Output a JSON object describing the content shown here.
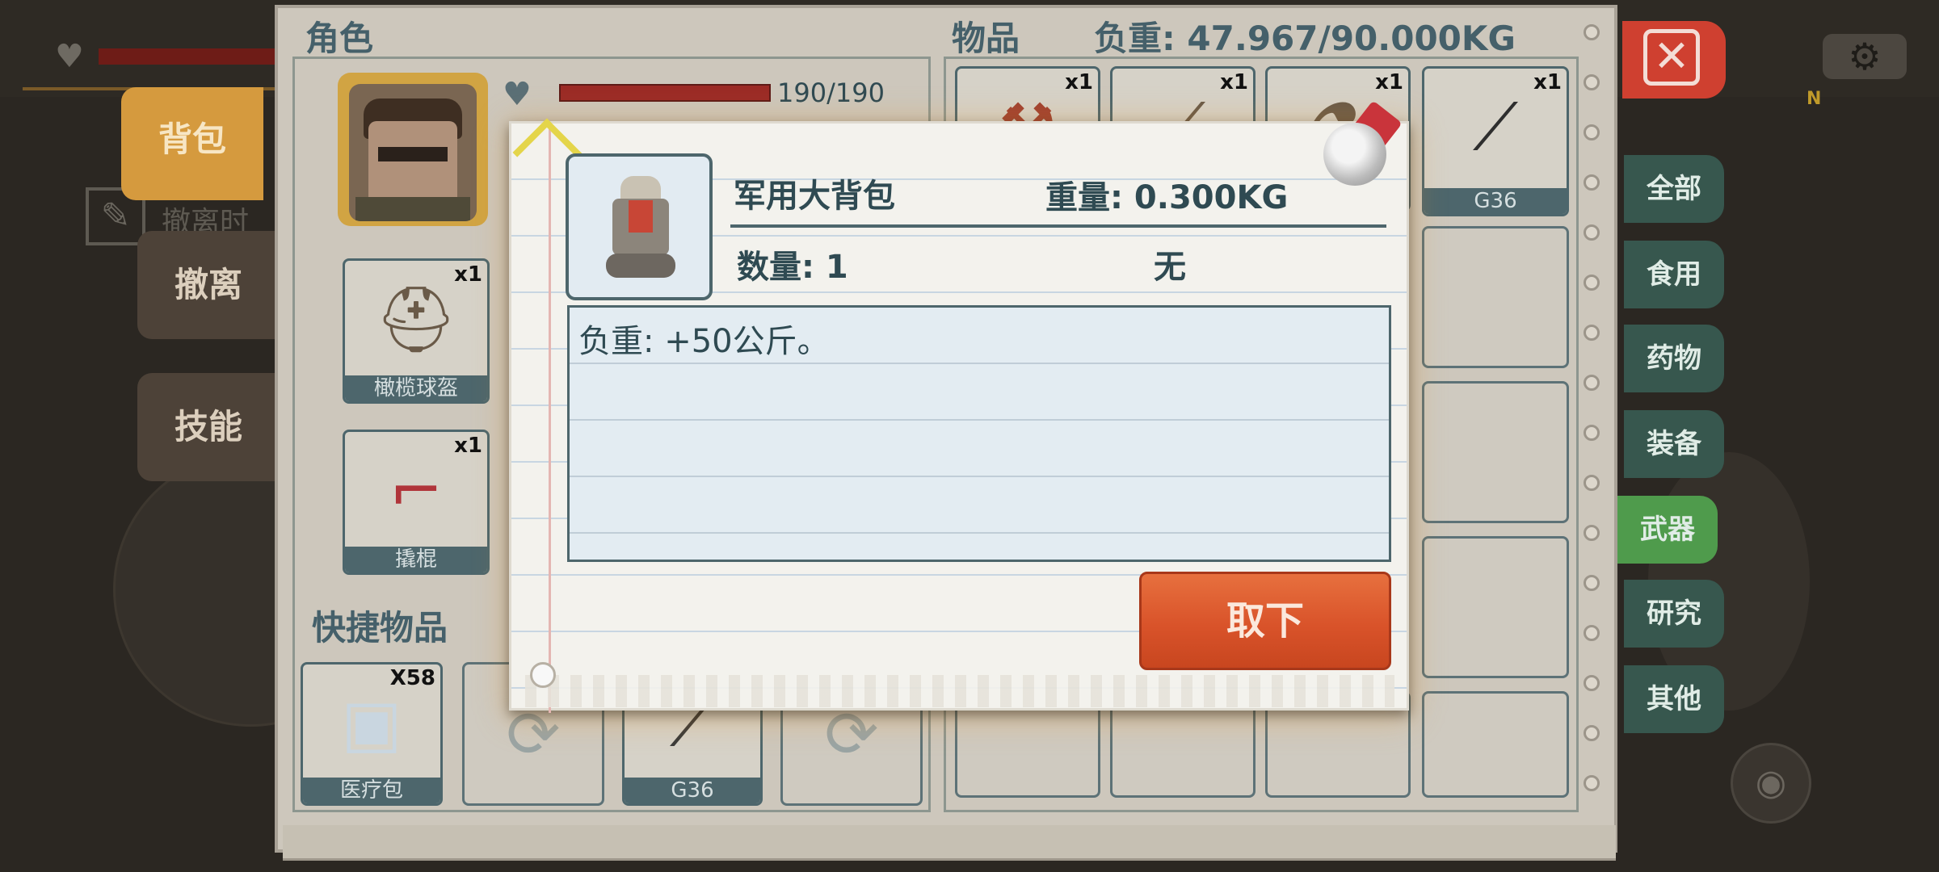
{
  "hud": {
    "heart_icon": "heart-pulse-icon",
    "settings_icon": "gear-icon",
    "compass_label": "N",
    "view_icon": "eye-icon"
  },
  "side_tabs": {
    "backpack": "背包",
    "evacuate": "撤离",
    "skills": "技能",
    "evac_hint": "撤离时"
  },
  "panel": {
    "role_title": "角色",
    "items_title": "物品",
    "weight": "负重: 47.967/90.000KG",
    "hp": "190/190",
    "hp_fraction": 1.0,
    "equipment": [
      {
        "name": "橄榄球盔",
        "qty": "x1",
        "icon": "helmet-icon"
      },
      {
        "name": "撬棍",
        "qty": "x1",
        "icon": "crowbar-icon"
      }
    ],
    "quick_title": "快捷物品",
    "quick_items": [
      {
        "name": "医疗包",
        "qty": "X58",
        "icon": "medkit-icon"
      },
      {
        "name": "",
        "qty": "",
        "icon": "recycle-icon"
      },
      {
        "name": "G36",
        "qty": "",
        "icon": "rifle-icon"
      },
      {
        "name": "",
        "qty": "",
        "icon": "recycle-icon"
      }
    ],
    "grid_items": [
      {
        "name": "",
        "qty": "x1",
        "icon": "hammer-icon"
      },
      {
        "name": "",
        "qty": "x1",
        "icon": "screwdriver-icon"
      },
      {
        "name": "",
        "qty": "x1",
        "icon": "extinguisher-icon"
      },
      {
        "name": "G36",
        "qty": "x1",
        "icon": "rifle-icon"
      }
    ]
  },
  "categories": {
    "close_icon": "close-icon",
    "items": [
      "全部",
      "食用",
      "药物",
      "装备",
      "武器",
      "研究",
      "其他"
    ],
    "active": "武器"
  },
  "popup": {
    "item_name": "军用大背包",
    "weight": "重量: 0.300KG",
    "count": "数量: 1",
    "extra": "无",
    "description": "负重: +50公斤。",
    "button": "取下",
    "item_icon": "backpack-icon",
    "pin_icon": "pushpin-icon"
  }
}
